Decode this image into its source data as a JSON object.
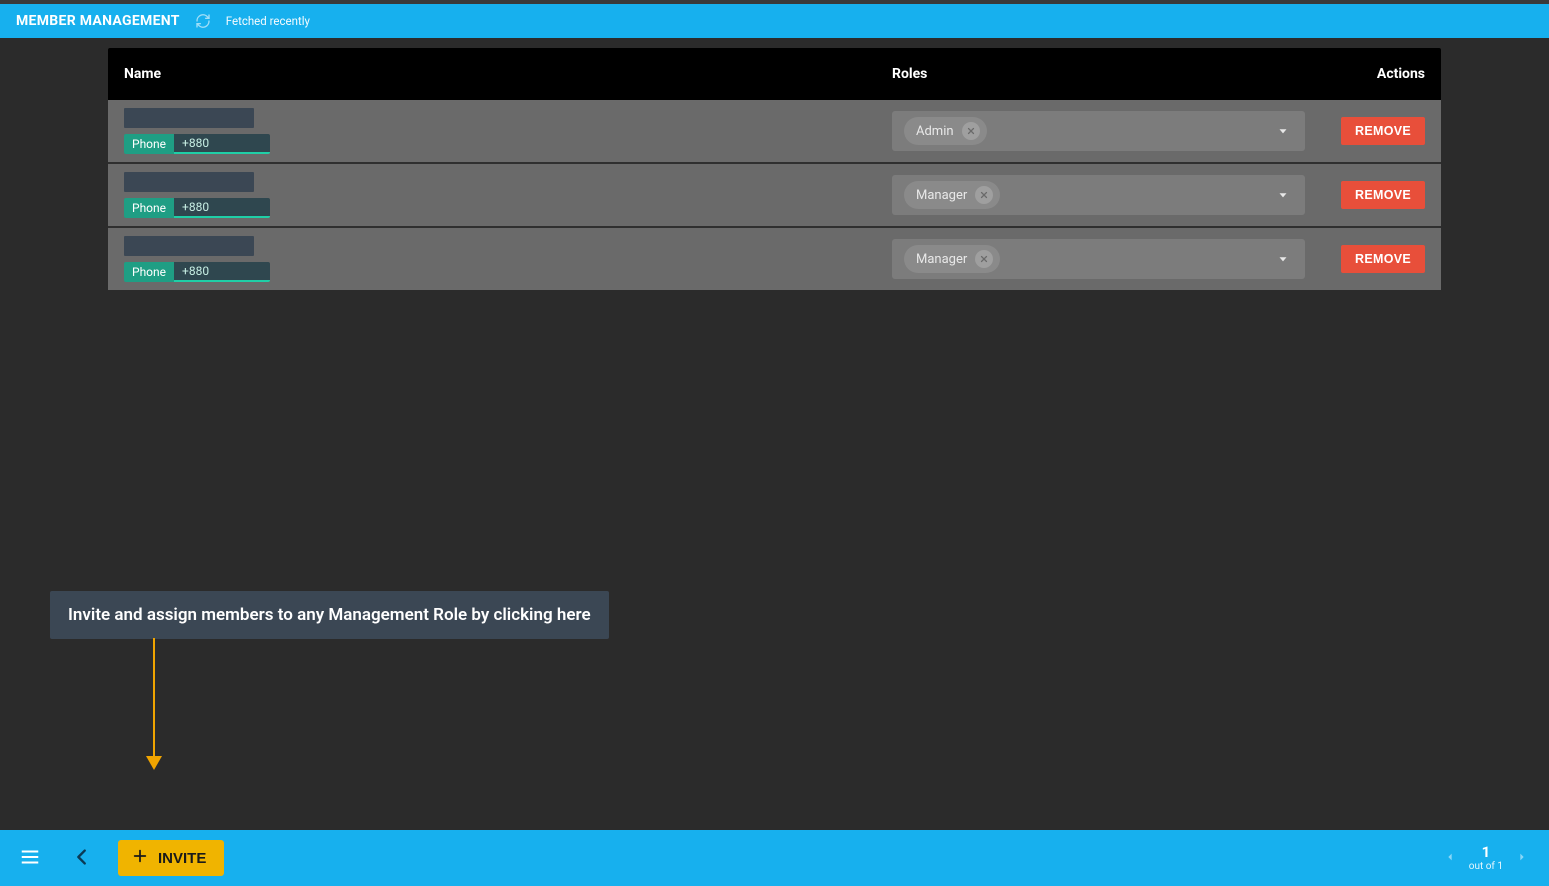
{
  "header": {
    "title": "MEMBER MANAGEMENT",
    "fetched_label": "Fetched recently"
  },
  "table": {
    "columns": {
      "name": "Name",
      "roles": "Roles",
      "actions": "Actions"
    },
    "remove_label": "REMOVE",
    "phone_label": "Phone",
    "rows": [
      {
        "phone_prefix": "+880",
        "role": "Admin"
      },
      {
        "phone_prefix": "+880",
        "role": "Manager"
      },
      {
        "phone_prefix": "+880",
        "role": "Manager"
      }
    ]
  },
  "callout": {
    "text": "Invite and assign members to any Management Role by clicking here"
  },
  "footer": {
    "invite_label": "INVITE",
    "page_current": "1",
    "page_total_label": "out of 1"
  },
  "colors": {
    "brand": "#17b0ee",
    "danger": "#e84f3a",
    "accentYellow": "#f0b400",
    "arrow": "#f0a400",
    "teal": "#1f9e84"
  }
}
